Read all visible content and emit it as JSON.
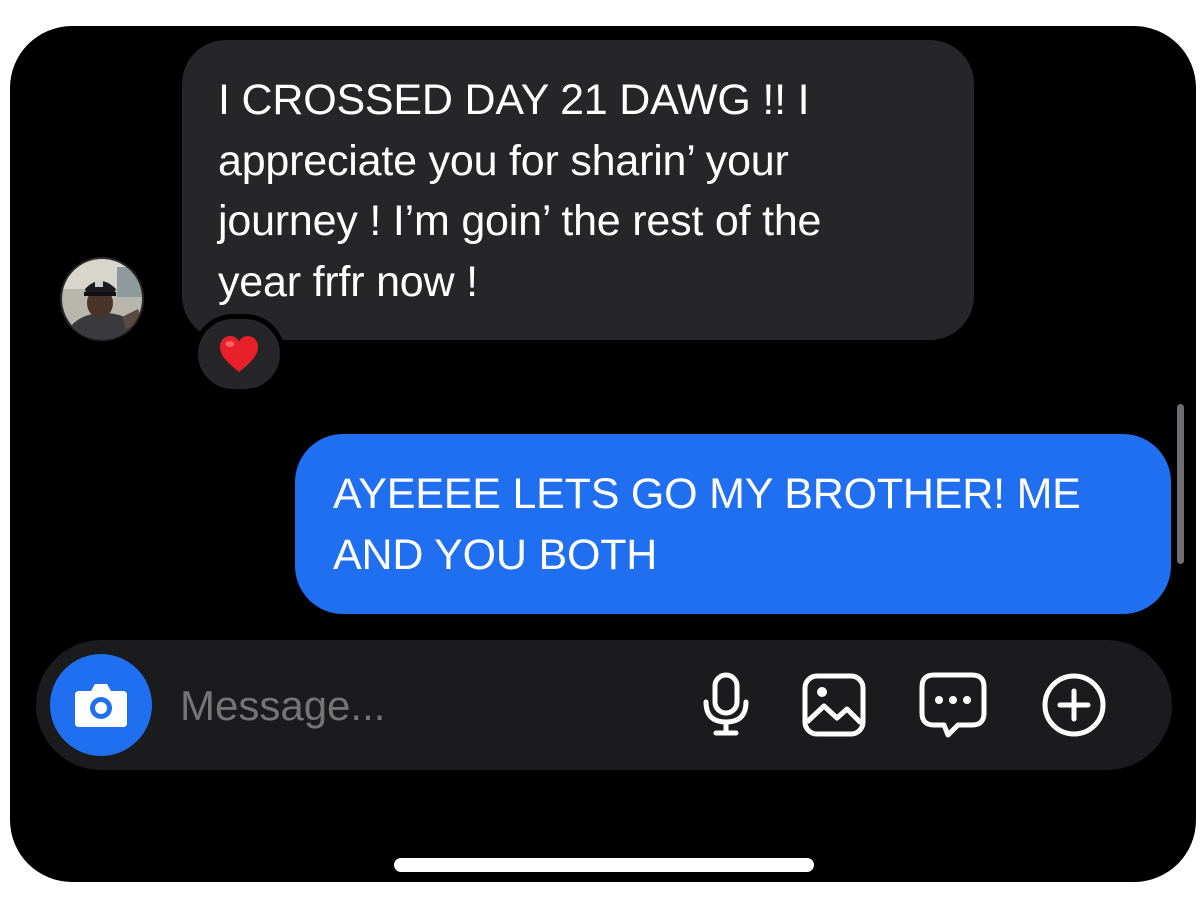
{
  "conversation": {
    "incoming_message": {
      "lines": [
        "I CROSSED DAY 21 DAWG !! I",
        "appreciate you for sharin’ your",
        "journey ! I’m goin’ the rest of the",
        "year frfr now !"
      ],
      "reaction": "❤️"
    },
    "outgoing_message": {
      "lines": [
        "AYEEEE LETS GO MY BROTHER! ME",
        "AND YOU BOTH"
      ]
    }
  },
  "composer": {
    "placeholder": "Message...",
    "camera_icon": "camera-icon",
    "tools": [
      "microphone-icon",
      "gallery-icon",
      "chat-bubble-icon",
      "plus-circle-icon"
    ]
  },
  "colors": {
    "background": "#000000",
    "incoming_bubble": "#262628",
    "outgoing_bubble": "#1f6ff0",
    "composer_bar": "#1b1b1d",
    "placeholder_text": "#8e8e93",
    "heart": "#e8202a"
  }
}
